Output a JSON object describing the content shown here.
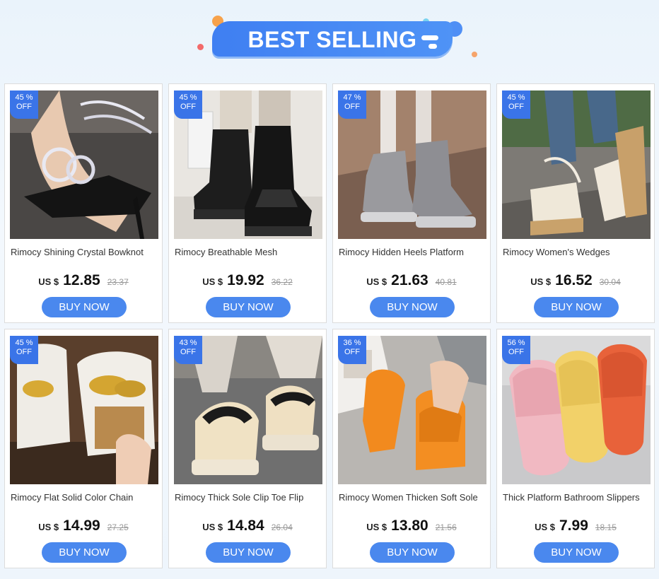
{
  "header": {
    "title": "BEST SELLING"
  },
  "colors": {
    "accent": "#4a88ee",
    "badge": "#3a74e8",
    "banner": "#4185f3"
  },
  "products": [
    {
      "name": "Rimocy Shining Crystal Bowknot",
      "discount": "45 %",
      "off": "OFF",
      "currency": "US $",
      "price": "12.85",
      "old_price": "23.37",
      "button": "BUY NOW"
    },
    {
      "name": "Rimocy Breathable Mesh",
      "discount": "45 %",
      "off": "OFF",
      "currency": "US $",
      "price": "19.92",
      "old_price": "36.22",
      "button": "BUY NOW"
    },
    {
      "name": "Rimocy Hidden Heels Platform",
      "discount": "47 %",
      "off": "OFF",
      "currency": "US $",
      "price": "21.63",
      "old_price": "40.81",
      "button": "BUY NOW"
    },
    {
      "name": "Rimocy Women's Wedges",
      "discount": "45 %",
      "off": "OFF",
      "currency": "US $",
      "price": "16.52",
      "old_price": "30.04",
      "button": "BUY NOW"
    },
    {
      "name": "Rimocy Flat Solid Color Chain",
      "discount": "45 %",
      "off": "OFF",
      "currency": "US $",
      "price": "14.99",
      "old_price": "27.25",
      "button": "BUY NOW"
    },
    {
      "name": "Rimocy Thick Sole Clip Toe Flip",
      "discount": "43 %",
      "off": "OFF",
      "currency": "US $",
      "price": "14.84",
      "old_price": "26.04",
      "button": "BUY NOW"
    },
    {
      "name": "Rimocy Women Thicken Soft Sole",
      "discount": "36 %",
      "off": "OFF",
      "currency": "US $",
      "price": "13.80",
      "old_price": "21.56",
      "button": "BUY NOW"
    },
    {
      "name": "Thick Platform Bathroom Slippers",
      "discount": "56 %",
      "off": "OFF",
      "currency": "US $",
      "price": "7.99",
      "old_price": "18.15",
      "button": "BUY NOW"
    }
  ]
}
